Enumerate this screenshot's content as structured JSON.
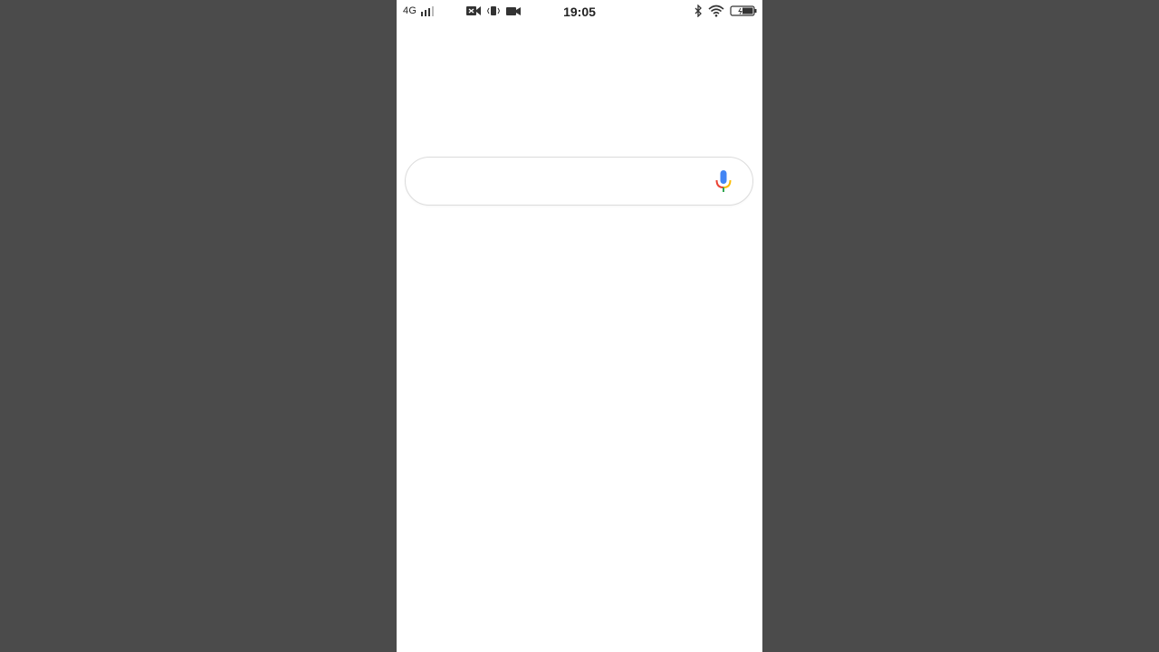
{
  "status_bar": {
    "network_label": "4G",
    "time": "19:05",
    "icons": {
      "signal": "signal-bars-icon",
      "video_call": "video-call-icon",
      "vibrate": "vibrate-icon",
      "camera": "video-camera-icon",
      "bluetooth": "bluetooth-icon",
      "wifi": "wifi-icon",
      "battery": "battery-icon"
    }
  },
  "search": {
    "value": "",
    "placeholder": "",
    "mic_icon": "microphone-icon"
  },
  "colors": {
    "background_outer": "#4b4b4b",
    "screen": "#ffffff",
    "mic_blue": "#4285f4",
    "mic_red": "#ea4335",
    "mic_yellow": "#fbbc05",
    "mic_green": "#34a853"
  }
}
